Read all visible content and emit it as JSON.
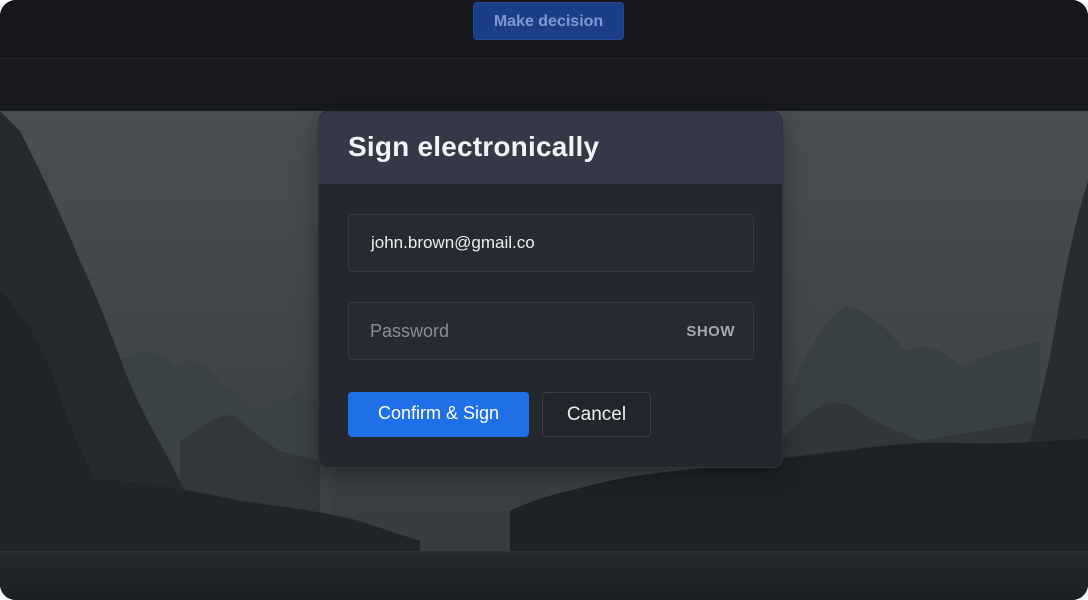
{
  "toolbar": {
    "make_decision_label": "Make decision"
  },
  "dialog": {
    "title": "Sign electronically",
    "email": {
      "value": "john.brown@gmail.co"
    },
    "password": {
      "placeholder": "Password",
      "show_label": "SHOW"
    },
    "confirm_label": "Confirm & Sign",
    "cancel_label": "Cancel"
  },
  "colors": {
    "accent": "#1f6fe6",
    "header": "#353846",
    "dialog_bg": "#24272e",
    "topbar_bg": "#16181d"
  }
}
